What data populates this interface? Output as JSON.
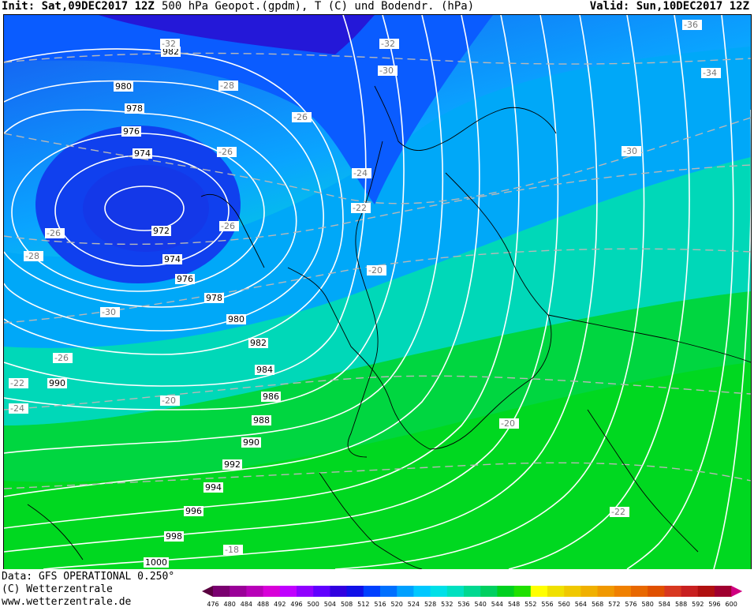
{
  "header": {
    "init": "Init: Sat,09DEC2017 12Z",
    "title": "500 hPa Geopot.(gpdm), T (C) und Bodendr. (hPa)",
    "valid": "Valid: Sun,10DEC2017 12Z"
  },
  "footer": {
    "data_source": "Data: GFS OPERATIONAL 0.250°",
    "copyright": "(C) Wetterzentrale",
    "website": "www.wetterzentrale.de"
  },
  "legend": {
    "values": [
      476,
      480,
      484,
      488,
      492,
      496,
      500,
      504,
      508,
      512,
      516,
      520,
      524,
      528,
      532,
      536,
      540,
      544,
      548,
      552,
      556,
      560,
      564,
      568,
      572,
      576,
      580,
      584,
      588,
      592,
      596,
      600
    ],
    "colors": [
      "#5a0040",
      "#7a0070",
      "#9a0098",
      "#b800b8",
      "#d800d8",
      "#c000ff",
      "#9000ff",
      "#6000ff",
      "#3000e0",
      "#1010e8",
      "#0040ff",
      "#0070ff",
      "#00a0ff",
      "#00c8ff",
      "#00e0e8",
      "#00e0c0",
      "#00d890",
      "#00d060",
      "#00d020",
      "#20e000",
      "#ffff00",
      "#f0e000",
      "#f0c800",
      "#f0b000",
      "#f09800",
      "#f08000",
      "#e86800",
      "#e05000",
      "#d83820",
      "#c82020",
      "#b01010",
      "#a00030",
      "#d00080"
    ]
  },
  "map": {
    "pressure_labels": [
      "982",
      "980",
      "978",
      "976",
      "974",
      "972",
      "974",
      "976",
      "978",
      "980",
      "982",
      "984",
      "986",
      "988",
      "990",
      "992",
      "994",
      "996",
      "998",
      "1000",
      "990"
    ],
    "temperature_labels": [
      "-30",
      "-28",
      "-26",
      "-26",
      "-26",
      "-28",
      "-26",
      "-24",
      "-22",
      "-20",
      "-20",
      "-20",
      "-22",
      "-18",
      "-22",
      "-24",
      "-30",
      "-32",
      "-32",
      "-30",
      "-36",
      "-34",
      "-30",
      "-26"
    ]
  }
}
